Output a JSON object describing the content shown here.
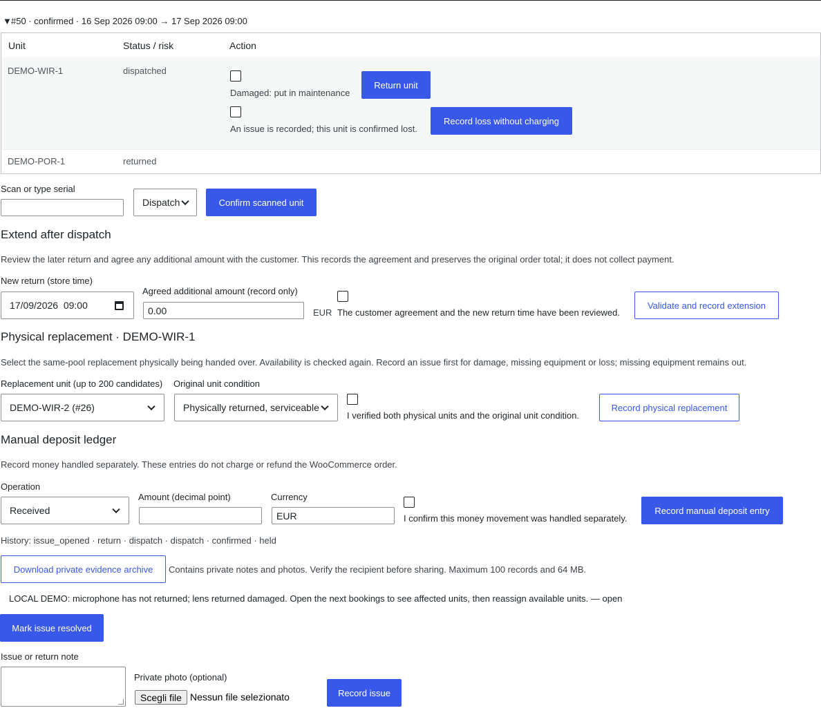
{
  "booking": {
    "summary": "#50 · confirmed · 16 Sep 2026 09:00 → 17 Sep 2026 09:00"
  },
  "units_table": {
    "headers": [
      "Unit",
      "Status / risk",
      "Action"
    ],
    "rows": [
      {
        "unit": "DEMO-WIR-1",
        "status": "dispatched",
        "damaged_label": "Damaged: put in maintenance",
        "return_button": "Return unit",
        "loss_label": "An issue is recorded; this unit is confirmed lost.",
        "loss_button": "Record loss without charging"
      },
      {
        "unit": "DEMO-POR-1",
        "status": "returned"
      }
    ]
  },
  "scan": {
    "label": "Scan or type serial",
    "value": "",
    "mode": "Dispatch",
    "confirm_button": "Confirm scanned unit"
  },
  "extend": {
    "heading": "Extend after dispatch",
    "description": "Review the later return and agree any additional amount with the customer. This records the agreement and preserves the original order total; it does not collect payment.",
    "new_return_label": "New return (store time)",
    "new_return_value": "17/09/2026  09:00",
    "amount_label": "Agreed additional amount (record only)",
    "amount_value": "0.00",
    "currency": "EUR",
    "confirm_label": "The customer agreement and the new return time have been reviewed.",
    "button": "Validate and record extension"
  },
  "replacement": {
    "heading": "Physical replacement · DEMO-WIR-1",
    "description": "Select the same-pool replacement physically being handed over. Availability is checked again. Record an issue first for damage, missing equipment or loss; missing equipment remains out.",
    "unit_label": "Replacement unit (up to 200 candidates)",
    "unit_value": "DEMO-WIR-2 (#26)",
    "condition_label": "Original unit condition",
    "condition_value": "Physically returned, serviceable",
    "confirm_label": "I verified both physical units and the original unit condition.",
    "button": "Record physical replacement"
  },
  "deposit": {
    "heading": "Manual deposit ledger",
    "description": "Record money handled separately. These entries do not charge or refund the WooCommerce order.",
    "operation_label": "Operation",
    "operation_value": "Received",
    "amount_label": "Amount (decimal point)",
    "amount_value": "",
    "currency_label": "Currency",
    "currency_value": "EUR",
    "confirm_label": "I confirm this money movement was handled separately.",
    "button": "Record manual deposit entry"
  },
  "history": "History: issue_opened · return · dispatch · dispatch · confirmed · held",
  "evidence": {
    "button": "Download private evidence archive",
    "note": "Contains private notes and photos. Verify the recipient before sharing. Maximum 100 records and 64 MB."
  },
  "issue": {
    "text": "LOCAL DEMO: microphone has not returned; lens returned damaged. Open the next bookings to see affected units, then reassign available units. — open",
    "resolve_button": "Mark issue resolved",
    "note_label": "Issue or return note",
    "note_value": "",
    "photo_label": "Private photo (optional)",
    "file_button": "Scegli file",
    "file_status": "Nessun file selezionato",
    "record_button": "Record issue"
  },
  "colors": {
    "primary": "#3858e9",
    "text": "#1d2327",
    "row_bg": "#f6f7f7",
    "border": "#c3c4c7"
  }
}
